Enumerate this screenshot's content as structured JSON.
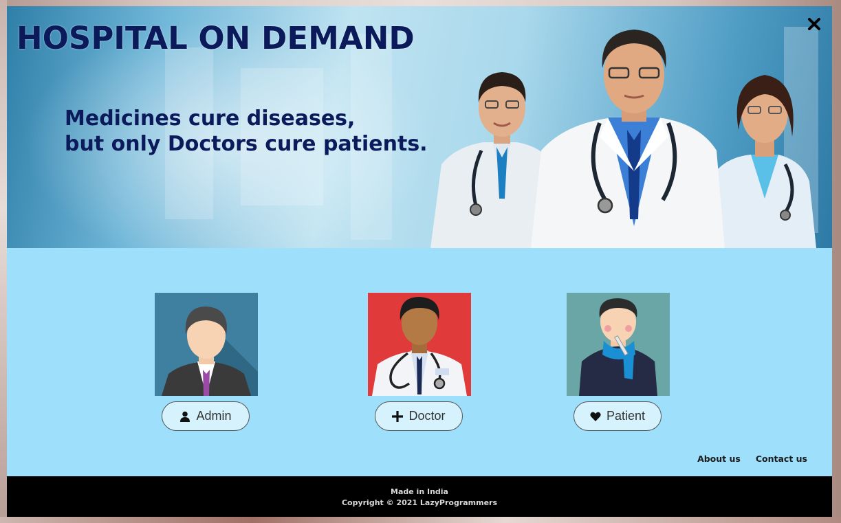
{
  "banner": {
    "title": "HOSPITAL ON DEMAND",
    "tagline_line1": "Medicines cure diseases,",
    "tagline_line2": "but only Doctors cure patients.",
    "close_icon": "close-icon"
  },
  "roles": [
    {
      "label": "Admin",
      "icon": "user-icon",
      "avatar_bg": "#3f7fa0"
    },
    {
      "label": "Doctor",
      "icon": "plus-icon",
      "avatar_bg": "#e03a3a"
    },
    {
      "label": "Patient",
      "icon": "heart-icon",
      "avatar_bg": "#6aa6a6"
    }
  ],
  "footer": {
    "links": [
      "About us",
      "Contact us"
    ],
    "made_in": "Made in India",
    "copyright": "Copyright © 2021 LazyProgrammers"
  },
  "colors": {
    "modal_bg": "#9edffb",
    "title_color": "#0b1a5a",
    "button_bg": "#d6f2fd",
    "footer_bg": "#000000"
  }
}
